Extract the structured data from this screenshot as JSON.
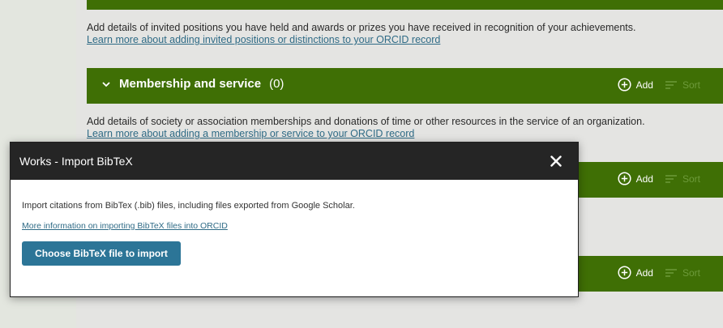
{
  "invited_positions": {
    "description": "Add details of invited positions you have held and awards or prizes you have received in recognition of your achievements.",
    "learn_more": "Learn more about adding invited positions or distinctions to your ORCID record"
  },
  "membership": {
    "title": "Membership and service",
    "count": "(0)",
    "add_label": "Add",
    "sort_label": "Sort",
    "description": "Add details of society or association memberships and donations of time or other resources in the service of an organization.",
    "learn_more": "Learn more about adding a membership or service to your ORCID record"
  },
  "section_3": {
    "add_label": "Add",
    "sort_label": "Sort"
  },
  "section_4": {
    "add_label": "Add",
    "sort_label": "Sort"
  },
  "modal": {
    "title": "Works - Import BibTeX",
    "description": "Import citations from BibTex (.bib) files, including files exported from Google Scholar.",
    "info_link": "More information on importing BibTeX files into ORCID",
    "button_label": "Choose BibTeX file to import"
  },
  "colors": {
    "section_green": "#3f6f05",
    "modal_header": "#252525",
    "button_blue": "#2c7597",
    "link_blue": "#2f6b86"
  }
}
